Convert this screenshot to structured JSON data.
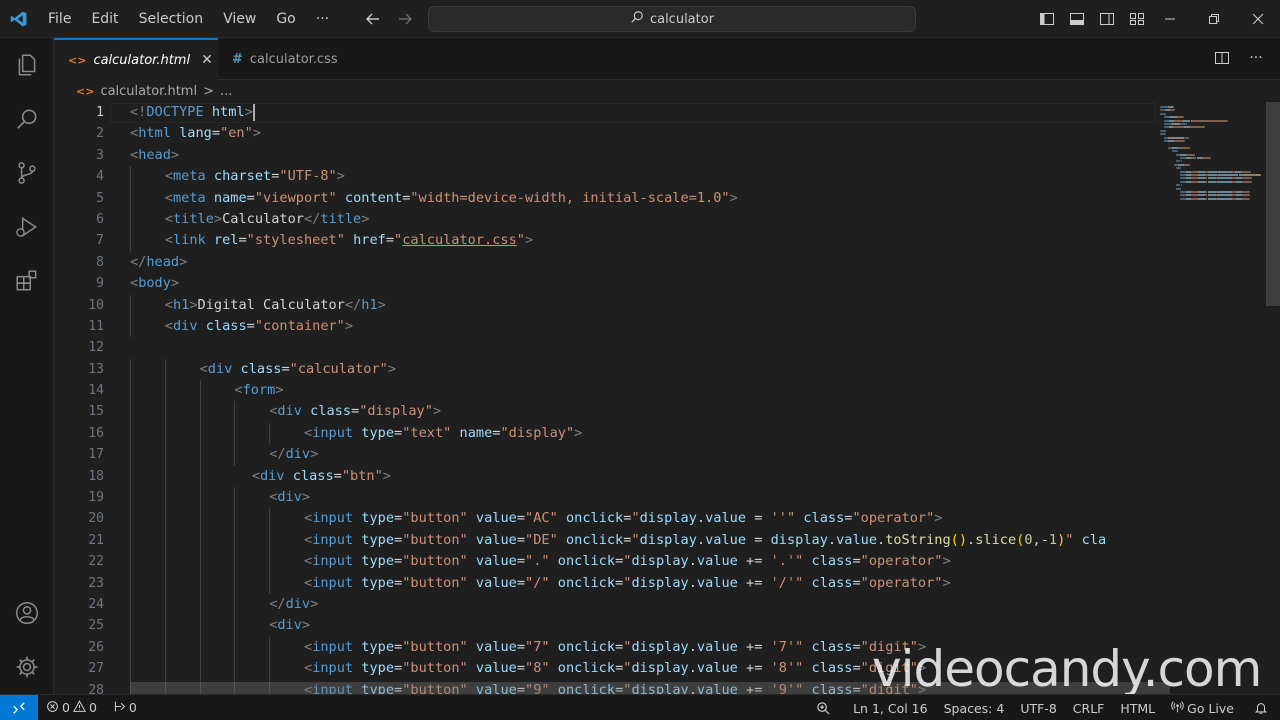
{
  "menu": [
    "File",
    "Edit",
    "Selection",
    "View",
    "Go",
    "···"
  ],
  "search": {
    "text": "calculator"
  },
  "tabs": [
    {
      "label": "calculator.html",
      "icon": "html-file-icon",
      "active": true
    },
    {
      "label": "calculator.css",
      "icon": "css-file-icon",
      "active": false
    }
  ],
  "breadcrumb": {
    "file": "calculator.html",
    "separator": ">",
    "more": "..."
  },
  "editor": {
    "line_numbers": [
      "1",
      "2",
      "3",
      "4",
      "5",
      "6",
      "7",
      "8",
      "9",
      "10",
      "11",
      "12",
      "13",
      "14",
      "15",
      "16",
      "17",
      "18",
      "19",
      "20",
      "21",
      "22",
      "23",
      "24",
      "25",
      "26",
      "27",
      "28"
    ],
    "current_line": "1"
  },
  "code_lines": [
    {
      "indent": 0,
      "tokens": [
        [
          "br",
          "<!"
        ],
        [
          "tag",
          "DOCTYPE"
        ],
        [
          "txt",
          " "
        ],
        [
          "attr",
          "html"
        ],
        [
          "br",
          ">"
        ]
      ]
    },
    {
      "indent": 0,
      "tokens": [
        [
          "br",
          "<"
        ],
        [
          "tag",
          "html"
        ],
        [
          "txt",
          " "
        ],
        [
          "attr",
          "lang"
        ],
        [
          "txt",
          "="
        ],
        [
          "str",
          "\"en\""
        ],
        [
          "br",
          ">"
        ]
      ]
    },
    {
      "indent": 0,
      "tokens": [
        [
          "br",
          "<"
        ],
        [
          "tag",
          "head"
        ],
        [
          "br",
          ">"
        ]
      ]
    },
    {
      "indent": 1,
      "tokens": [
        [
          "br",
          "<"
        ],
        [
          "tag",
          "meta"
        ],
        [
          "txt",
          " "
        ],
        [
          "attr",
          "charset"
        ],
        [
          "txt",
          "="
        ],
        [
          "str",
          "\"UTF-8\""
        ],
        [
          "br",
          ">"
        ]
      ]
    },
    {
      "indent": 1,
      "tokens": [
        [
          "br",
          "<"
        ],
        [
          "tag",
          "meta"
        ],
        [
          "txt",
          " "
        ],
        [
          "attr",
          "name"
        ],
        [
          "txt",
          "="
        ],
        [
          "str",
          "\"viewport\""
        ],
        [
          "txt",
          " "
        ],
        [
          "attr",
          "content"
        ],
        [
          "txt",
          "="
        ],
        [
          "str",
          "\"width=device-width, initial-scale=1.0\""
        ],
        [
          "br",
          ">"
        ]
      ]
    },
    {
      "indent": 1,
      "tokens": [
        [
          "br",
          "<"
        ],
        [
          "tag",
          "title"
        ],
        [
          "br",
          ">"
        ],
        [
          "txt",
          "Calculator"
        ],
        [
          "br",
          "</"
        ],
        [
          "tag",
          "title"
        ],
        [
          "br",
          ">"
        ]
      ]
    },
    {
      "indent": 1,
      "tokens": [
        [
          "br",
          "<"
        ],
        [
          "tag",
          "link"
        ],
        [
          "txt",
          " "
        ],
        [
          "attr",
          "rel"
        ],
        [
          "txt",
          "="
        ],
        [
          "str",
          "\"stylesheet\""
        ],
        [
          "txt",
          " "
        ],
        [
          "attr",
          "href"
        ],
        [
          "txt",
          "="
        ],
        [
          "str",
          "\""
        ],
        [
          "link",
          "calculator.css"
        ],
        [
          "str",
          "\""
        ],
        [
          "br",
          ">"
        ]
      ]
    },
    {
      "indent": 0,
      "tokens": [
        [
          "br",
          "</"
        ],
        [
          "tag",
          "head"
        ],
        [
          "br",
          ">"
        ]
      ]
    },
    {
      "indent": 0,
      "tokens": [
        [
          "br",
          "<"
        ],
        [
          "tag",
          "body"
        ],
        [
          "br",
          ">"
        ]
      ]
    },
    {
      "indent": 1,
      "tokens": [
        [
          "br",
          "<"
        ],
        [
          "tag",
          "h1"
        ],
        [
          "br",
          ">"
        ],
        [
          "txt",
          "Digital Calculator"
        ],
        [
          "br",
          "</"
        ],
        [
          "tag",
          "h1"
        ],
        [
          "br",
          ">"
        ]
      ]
    },
    {
      "indent": 1,
      "tokens": [
        [
          "br",
          "<"
        ],
        [
          "tag",
          "div"
        ],
        [
          "txt",
          " "
        ],
        [
          "attr",
          "class"
        ],
        [
          "txt",
          "="
        ],
        [
          "str",
          "\"container\""
        ],
        [
          "br",
          ">"
        ]
      ]
    },
    {
      "indent": 0,
      "tokens": []
    },
    {
      "indent": 2,
      "tokens": [
        [
          "br",
          "<"
        ],
        [
          "tag",
          "div"
        ],
        [
          "txt",
          " "
        ],
        [
          "attr",
          "class"
        ],
        [
          "txt",
          "="
        ],
        [
          "str",
          "\"calculator\""
        ],
        [
          "br",
          ">"
        ]
      ]
    },
    {
      "indent": 3,
      "tokens": [
        [
          "br",
          "<"
        ],
        [
          "tag",
          "form"
        ],
        [
          "br",
          ">"
        ]
      ]
    },
    {
      "indent": 4,
      "tokens": [
        [
          "br",
          "<"
        ],
        [
          "tag",
          "div"
        ],
        [
          "txt",
          " "
        ],
        [
          "attr",
          "class"
        ],
        [
          "txt",
          "="
        ],
        [
          "str",
          "\"display\""
        ],
        [
          "br",
          ">"
        ]
      ]
    },
    {
      "indent": 5,
      "tokens": [
        [
          "br",
          "<"
        ],
        [
          "tag",
          "input"
        ],
        [
          "txt",
          " "
        ],
        [
          "attr",
          "type"
        ],
        [
          "txt",
          "="
        ],
        [
          "str",
          "\"text\""
        ],
        [
          "txt",
          " "
        ],
        [
          "attr",
          "name"
        ],
        [
          "txt",
          "="
        ],
        [
          "str",
          "\"display\""
        ],
        [
          "br",
          ">"
        ]
      ]
    },
    {
      "indent": 4,
      "tokens": [
        [
          "br",
          "</"
        ],
        [
          "tag",
          "div"
        ],
        [
          "br",
          ">"
        ]
      ]
    },
    {
      "indent": 3.5,
      "tokens": [
        [
          "br",
          "<"
        ],
        [
          "tag",
          "div"
        ],
        [
          "txt",
          " "
        ],
        [
          "attr",
          "class"
        ],
        [
          "txt",
          "="
        ],
        [
          "str",
          "\"btn\""
        ],
        [
          "br",
          ">"
        ]
      ]
    },
    {
      "indent": 4,
      "tokens": [
        [
          "br",
          "<"
        ],
        [
          "tag",
          "div"
        ],
        [
          "br",
          ">"
        ]
      ]
    },
    {
      "indent": 5,
      "tokens": [
        [
          "br",
          "<"
        ],
        [
          "tag",
          "input"
        ],
        [
          "txt",
          " "
        ],
        [
          "attr",
          "type"
        ],
        [
          "txt",
          "="
        ],
        [
          "str",
          "\"button\""
        ],
        [
          "txt",
          " "
        ],
        [
          "attr",
          "value"
        ],
        [
          "txt",
          "="
        ],
        [
          "str",
          "\"AC\""
        ],
        [
          "txt",
          " "
        ],
        [
          "attr",
          "onclick"
        ],
        [
          "txt",
          "="
        ],
        [
          "str",
          "\""
        ],
        [
          "attr",
          "display"
        ],
        [
          "txt",
          "."
        ],
        [
          "attr",
          "value"
        ],
        [
          "txt",
          " = "
        ],
        [
          "str",
          "''\""
        ],
        [
          "txt",
          " "
        ],
        [
          "attr",
          "class"
        ],
        [
          "txt",
          "="
        ],
        [
          "str",
          "\"operator\""
        ],
        [
          "br",
          ">"
        ]
      ]
    },
    {
      "indent": 5,
      "tokens": [
        [
          "br",
          "<"
        ],
        [
          "tag",
          "input"
        ],
        [
          "txt",
          " "
        ],
        [
          "attr",
          "type"
        ],
        [
          "txt",
          "="
        ],
        [
          "str",
          "\"button\""
        ],
        [
          "txt",
          " "
        ],
        [
          "attr",
          "value"
        ],
        [
          "txt",
          "="
        ],
        [
          "str",
          "\"DE\""
        ],
        [
          "txt",
          " "
        ],
        [
          "attr",
          "onclick"
        ],
        [
          "txt",
          "="
        ],
        [
          "str",
          "\""
        ],
        [
          "attr",
          "display"
        ],
        [
          "txt",
          "."
        ],
        [
          "attr",
          "value"
        ],
        [
          "txt",
          " = "
        ],
        [
          "attr",
          "display"
        ],
        [
          "txt",
          "."
        ],
        [
          "attr",
          "value"
        ],
        [
          "txt",
          "."
        ],
        [
          "fn",
          "toString"
        ],
        [
          "brk",
          "()"
        ],
        [
          "txt",
          "."
        ],
        [
          "fn",
          "slice"
        ],
        [
          "brk",
          "("
        ],
        [
          "num",
          "0"
        ],
        [
          "txt",
          ",-"
        ],
        [
          "num",
          "1"
        ],
        [
          "brk",
          ")"
        ],
        [
          "str",
          "\""
        ],
        [
          "txt",
          " "
        ],
        [
          "attr",
          "cla"
        ]
      ]
    },
    {
      "indent": 5,
      "tokens": [
        [
          "br",
          "<"
        ],
        [
          "tag",
          "input"
        ],
        [
          "txt",
          " "
        ],
        [
          "attr",
          "type"
        ],
        [
          "txt",
          "="
        ],
        [
          "str",
          "\"button\""
        ],
        [
          "txt",
          " "
        ],
        [
          "attr",
          "value"
        ],
        [
          "txt",
          "="
        ],
        [
          "str",
          "\".\""
        ],
        [
          "txt",
          " "
        ],
        [
          "attr",
          "onclick"
        ],
        [
          "txt",
          "="
        ],
        [
          "str",
          "\""
        ],
        [
          "attr",
          "display"
        ],
        [
          "txt",
          "."
        ],
        [
          "attr",
          "value"
        ],
        [
          "txt",
          " += "
        ],
        [
          "str",
          "'.'\""
        ],
        [
          "txt",
          " "
        ],
        [
          "attr",
          "class"
        ],
        [
          "txt",
          "="
        ],
        [
          "str",
          "\"operator\""
        ],
        [
          "br",
          ">"
        ]
      ]
    },
    {
      "indent": 5,
      "tokens": [
        [
          "br",
          "<"
        ],
        [
          "tag",
          "input"
        ],
        [
          "txt",
          " "
        ],
        [
          "attr",
          "type"
        ],
        [
          "txt",
          "="
        ],
        [
          "str",
          "\"button\""
        ],
        [
          "txt",
          " "
        ],
        [
          "attr",
          "value"
        ],
        [
          "txt",
          "="
        ],
        [
          "str",
          "\"/\""
        ],
        [
          "txt",
          " "
        ],
        [
          "attr",
          "onclick"
        ],
        [
          "txt",
          "="
        ],
        [
          "str",
          "\""
        ],
        [
          "attr",
          "display"
        ],
        [
          "txt",
          "."
        ],
        [
          "attr",
          "value"
        ],
        [
          "txt",
          " += "
        ],
        [
          "str",
          "'/'\""
        ],
        [
          "txt",
          " "
        ],
        [
          "attr",
          "class"
        ],
        [
          "txt",
          "="
        ],
        [
          "str",
          "\"operator\""
        ],
        [
          "br",
          ">"
        ]
      ]
    },
    {
      "indent": 4,
      "tokens": [
        [
          "br",
          "</"
        ],
        [
          "tag",
          "div"
        ],
        [
          "br",
          ">"
        ]
      ]
    },
    {
      "indent": 4,
      "tokens": [
        [
          "br",
          "<"
        ],
        [
          "tag",
          "div"
        ],
        [
          "br",
          ">"
        ]
      ]
    },
    {
      "indent": 5,
      "tokens": [
        [
          "br",
          "<"
        ],
        [
          "tag",
          "input"
        ],
        [
          "txt",
          " "
        ],
        [
          "attr",
          "type"
        ],
        [
          "txt",
          "="
        ],
        [
          "str",
          "\"button\""
        ],
        [
          "txt",
          " "
        ],
        [
          "attr",
          "value"
        ],
        [
          "txt",
          "="
        ],
        [
          "str",
          "\"7\""
        ],
        [
          "txt",
          " "
        ],
        [
          "attr",
          "onclick"
        ],
        [
          "txt",
          "="
        ],
        [
          "str",
          "\""
        ],
        [
          "attr",
          "display"
        ],
        [
          "txt",
          "."
        ],
        [
          "attr",
          "value"
        ],
        [
          "txt",
          " += "
        ],
        [
          "str",
          "'7'\""
        ],
        [
          "txt",
          " "
        ],
        [
          "attr",
          "class"
        ],
        [
          "txt",
          "="
        ],
        [
          "str",
          "\"digit\""
        ],
        [
          "br",
          ">"
        ]
      ]
    },
    {
      "indent": 5,
      "tokens": [
        [
          "br",
          "<"
        ],
        [
          "tag",
          "input"
        ],
        [
          "txt",
          " "
        ],
        [
          "attr",
          "type"
        ],
        [
          "txt",
          "="
        ],
        [
          "str",
          "\"button\""
        ],
        [
          "txt",
          " "
        ],
        [
          "attr",
          "value"
        ],
        [
          "txt",
          "="
        ],
        [
          "str",
          "\"8\""
        ],
        [
          "txt",
          " "
        ],
        [
          "attr",
          "onclick"
        ],
        [
          "txt",
          "="
        ],
        [
          "str",
          "\""
        ],
        [
          "attr",
          "display"
        ],
        [
          "txt",
          "."
        ],
        [
          "attr",
          "value"
        ],
        [
          "txt",
          " += "
        ],
        [
          "str",
          "'8'\""
        ],
        [
          "txt",
          " "
        ],
        [
          "attr",
          "class"
        ],
        [
          "txt",
          "="
        ],
        [
          "str",
          "\"digit\""
        ],
        [
          "br",
          ">"
        ]
      ]
    },
    {
      "indent": 5,
      "tokens": [
        [
          "br",
          "<"
        ],
        [
          "tag",
          "input"
        ],
        [
          "txt",
          " "
        ],
        [
          "attr",
          "type"
        ],
        [
          "txt",
          "="
        ],
        [
          "str",
          "\"button\""
        ],
        [
          "txt",
          " "
        ],
        [
          "attr",
          "value"
        ],
        [
          "txt",
          "="
        ],
        [
          "str",
          "\"9\""
        ],
        [
          "txt",
          " "
        ],
        [
          "attr",
          "onclick"
        ],
        [
          "txt",
          "="
        ],
        [
          "str",
          "\""
        ],
        [
          "attr",
          "display"
        ],
        [
          "txt",
          "."
        ],
        [
          "attr",
          "value"
        ],
        [
          "txt",
          " += "
        ],
        [
          "str",
          "'9'\""
        ],
        [
          "txt",
          " "
        ],
        [
          "attr",
          "class"
        ],
        [
          "txt",
          "="
        ],
        [
          "str",
          "\"digit\""
        ],
        [
          "br",
          ">"
        ]
      ]
    }
  ],
  "status": {
    "remote_icon": "remote-icon",
    "errors": "0",
    "warnings": "0",
    "ports": "0",
    "position": "Ln 1, Col 16",
    "spaces": "Spaces: 4",
    "encoding": "UTF-8",
    "eol": "CRLF",
    "language": "HTML",
    "go_live": "Go Live"
  },
  "watermark": "videocandy.com",
  "colors": {
    "accent": "#0078d4",
    "tag": "#569cd6",
    "attribute": "#9cdcfe",
    "string": "#ce9178"
  }
}
